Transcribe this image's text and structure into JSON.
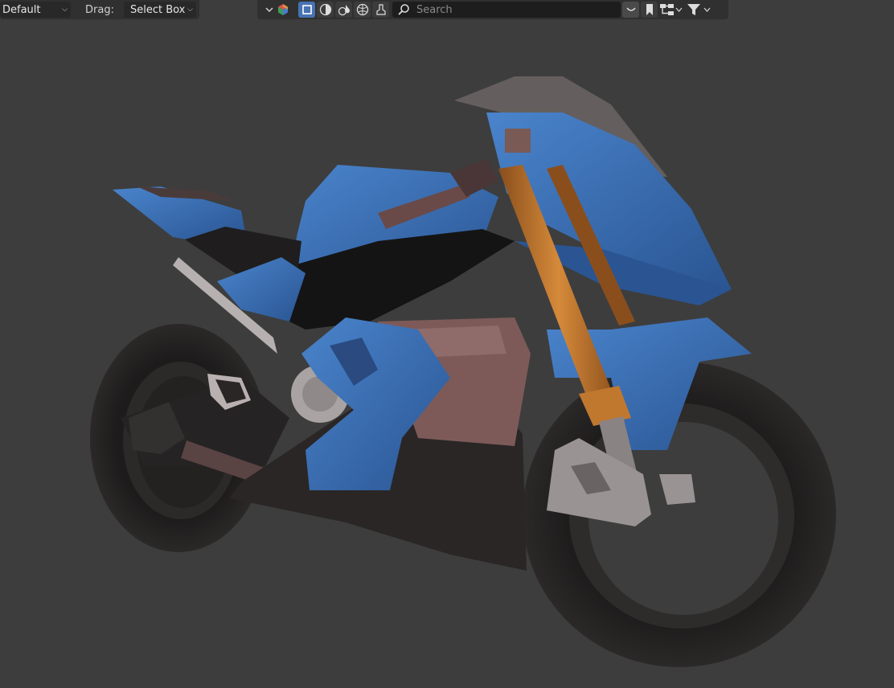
{
  "header": {
    "workspace_dropdown": "Default",
    "drag_label": "Drag:",
    "drag_dropdown": "Select Box"
  },
  "outliner_header": {
    "search_placeholder": "Search",
    "icons": [
      "chevron-down-icon",
      "scene-cube-icon",
      "select-mode-icon",
      "solid-shading-icon",
      "material-preview-icon",
      "rendered-shading-icon",
      "brush-icon",
      "search-icon",
      "collapse-icon",
      "bookmark-icon",
      "hierarchy-icon",
      "filter-icon"
    ]
  },
  "colors": {
    "background": "#3d3d3d",
    "header": "#303030",
    "active": "#4772b3",
    "fairing_blue": "#3b6fb6",
    "fork_orange": "#c67a2c"
  }
}
